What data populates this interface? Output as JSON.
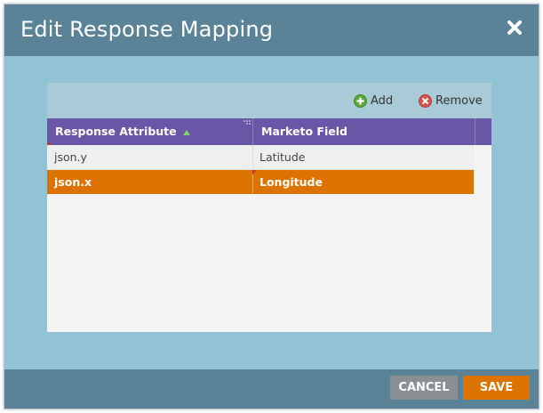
{
  "dialog": {
    "title": "Edit Response Mapping",
    "close_icon": "close-icon"
  },
  "toolbar": {
    "add_label": "Add",
    "remove_label": "Remove",
    "add_icon": "plus-circle-icon",
    "remove_icon": "x-circle-icon"
  },
  "grid": {
    "columns": [
      "Response Attribute",
      "Marketo Field"
    ],
    "sort_icon": "sort-ascending-icon",
    "rows": [
      {
        "attribute": "json.y",
        "field": "Latitude",
        "selected": false
      },
      {
        "attribute": "json.x",
        "field": "Longitude",
        "selected": true
      }
    ]
  },
  "footer": {
    "cancel_label": "CANCEL",
    "save_label": "SAVE"
  },
  "colors": {
    "title_bar": "#5b8397",
    "header": "#6a56a6",
    "selected_row": "#dc7300",
    "save": "#dc7300",
    "cancel": "#8a8f93"
  }
}
